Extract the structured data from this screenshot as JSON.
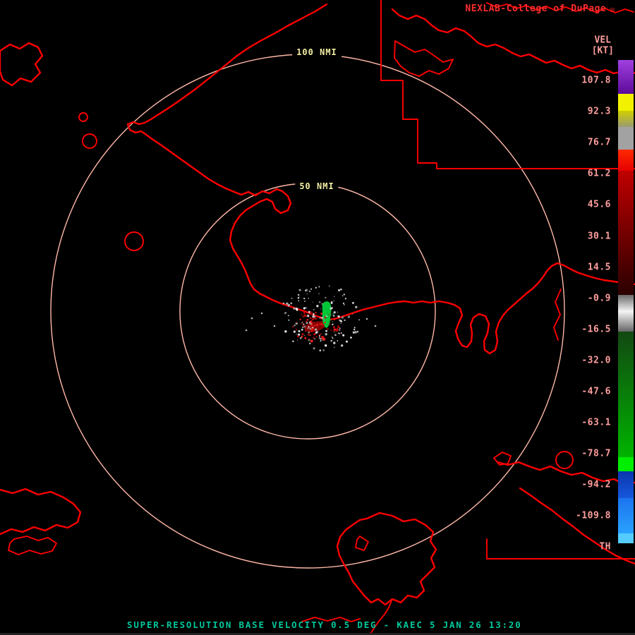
{
  "colors": {
    "background": "#000000",
    "map_line": "#ff0000",
    "ring": "#ffb8a8",
    "ring_label": "#f2eda1",
    "title": "#ff2e2e",
    "scale_label": "#ff9e9e",
    "caption": "#00c79c",
    "return_green": "#00c838",
    "return_red": "#b00000"
  },
  "header": {
    "title": "NEXLAB-College of DuPage",
    "logo_icon": "☒"
  },
  "range_rings": {
    "outer_label": "100 NMI",
    "inner_label": "50 NMI"
  },
  "scale": {
    "unit_line1": "VEL",
    "unit_line2": "[KT]",
    "threshold_label": "TH",
    "ticks": [
      "107.8",
      "92.3",
      "76.7",
      "61.2",
      "45.6",
      "30.1",
      "14.5",
      "-0.9",
      "-16.5",
      "-32.0",
      "-47.6",
      "-63.1",
      "-78.7",
      "-94.2",
      "-109.8"
    ],
    "colorbar_segments": [
      {
        "from": 85,
        "to": 133,
        "css": "linear-gradient(#a040e0,#5c0a9a)"
      },
      {
        "from": 133,
        "to": 157,
        "css": "#f2f200"
      },
      {
        "from": 157,
        "to": 180,
        "css": "linear-gradient(#d0d000,#9a9a72)"
      },
      {
        "from": 180,
        "to": 212,
        "css": "#a2a2a2"
      },
      {
        "from": 212,
        "to": 242,
        "css": "linear-gradient(#ff2a00,#e60000)"
      },
      {
        "from": 242,
        "to": 418,
        "css": "linear-gradient(#c00000,#2a0000)"
      },
      {
        "from": 418,
        "to": 470,
        "css": "linear-gradient(#6a6a6a,#f4f4f4 45%,#666666)"
      },
      {
        "from": 470,
        "to": 648,
        "css": "linear-gradient(#124812,#00b400)"
      },
      {
        "from": 648,
        "to": 668,
        "css": "#00ee00"
      },
      {
        "from": 668,
        "to": 706,
        "css": "linear-gradient(#0a36ae,#1658dc)"
      },
      {
        "from": 706,
        "to": 756,
        "css": "linear-gradient(#1b74ee,#2aa2ff)"
      },
      {
        "from": 756,
        "to": 770,
        "css": "#54ccff"
      }
    ]
  },
  "footer": {
    "caption": "SUPER-RESOLUTION BASE VELOCITY 0.5 DEG - KAEC 5 JAN 26 13:20"
  }
}
